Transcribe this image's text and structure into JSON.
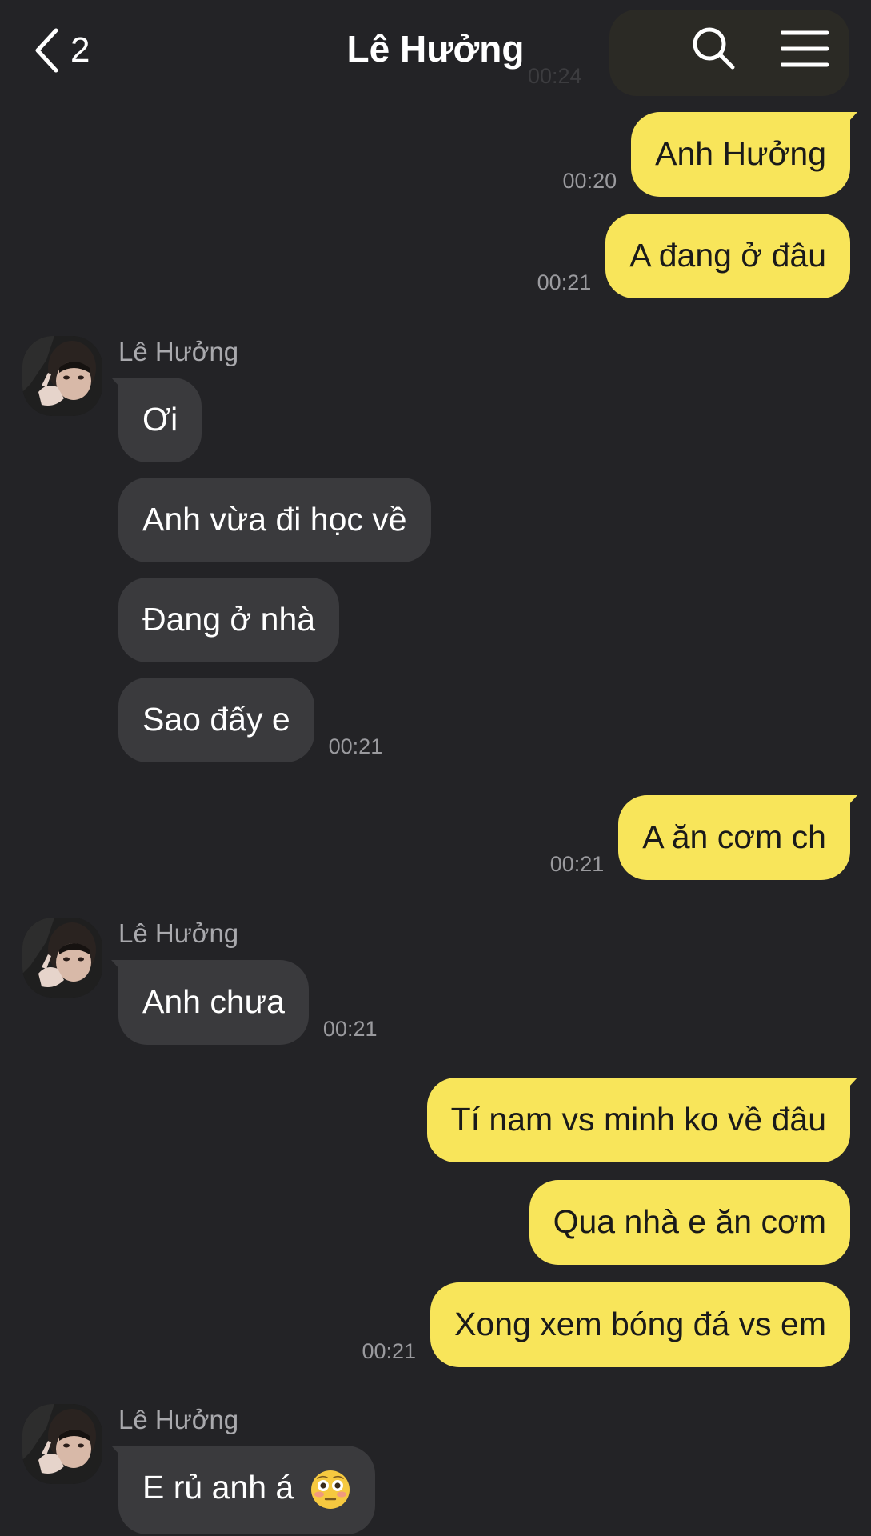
{
  "header": {
    "back_count": "2",
    "title": "Lê Hưởng",
    "ghost_time": "00:24"
  },
  "icons": {
    "back": "chevron-left-icon",
    "search": "search-icon",
    "menu": "hamburger-menu-icon"
  },
  "colors": {
    "background": "#232326",
    "my_bubble": "#f8e55a",
    "their_bubble": "#3a3a3d",
    "timestamp": "#9a9a9e"
  },
  "messages": [
    {
      "from": "me",
      "text": "Anh Hưởng",
      "time": "00:20"
    },
    {
      "from": "me",
      "text": "A đang ở đâu",
      "time": "00:21"
    },
    {
      "from": "them",
      "sender": "Lê Hưởng",
      "text": "Ơi"
    },
    {
      "from": "them",
      "text": "Anh vừa đi học về"
    },
    {
      "from": "them",
      "text": "Đang ở nhà"
    },
    {
      "from": "them",
      "text": "Sao đấy e",
      "time": "00:21"
    },
    {
      "from": "me",
      "text": "A ăn cơm ch",
      "time": "00:21"
    },
    {
      "from": "them",
      "sender": "Lê Hưởng",
      "text": "Anh chưa",
      "time": "00:21"
    },
    {
      "from": "me",
      "text": "Tí nam vs minh ko về đâu"
    },
    {
      "from": "me",
      "text": "Qua nhà e ăn cơm"
    },
    {
      "from": "me",
      "text": "Xong xem bóng đá vs em",
      "time": "00:21"
    },
    {
      "from": "them",
      "sender": "Lê Hưởng",
      "text": "E rủ anh á",
      "emoji": "flushed-face-emoji"
    }
  ]
}
